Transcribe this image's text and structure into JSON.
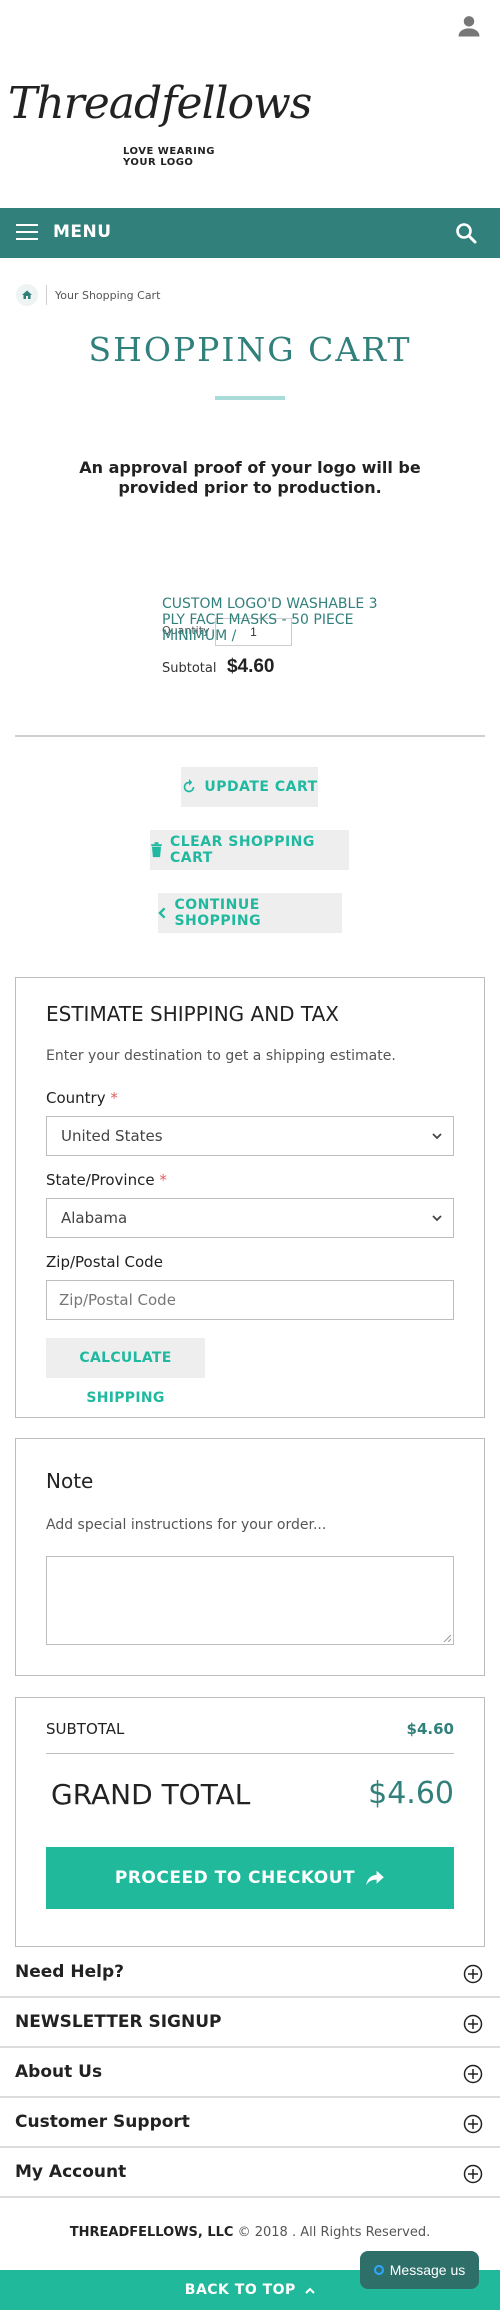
{
  "header": {
    "logo_text": "Threadfellows",
    "logo_tagline": "LOVE WEARING YOUR LOGO",
    "user_icon": "user-icon"
  },
  "nav": {
    "menu_label": "MENU",
    "menu_icon": "hamburger-icon",
    "search_icon": "search-icon",
    "bar_color": "#32807b"
  },
  "breadcrumb": {
    "home_icon": "home-icon",
    "current": "Your Shopping Cart"
  },
  "page": {
    "title": "SHOPPING CART",
    "approval_notice": "An approval proof of your logo will be provided prior to production."
  },
  "cart": {
    "item_name": "CUSTOM LOGO'D WASHABLE 3 PLY FACE MASKS - 50 PIECE MINIMUM /",
    "quantity_label": "Quantity",
    "quantity_value": "1",
    "subtotal_label": "Subtotal",
    "subtotal_value": "$4.60"
  },
  "actions": {
    "update_cart": "UPDATE CART",
    "clear_cart": "CLEAR SHOPPING CART",
    "continue_shopping": "CONTINUE SHOPPING"
  },
  "shipping": {
    "heading": "ESTIMATE SHIPPING AND TAX",
    "description": "Enter your destination to get a shipping estimate.",
    "country_label": "Country",
    "country_value": "United States",
    "state_label": "State/Province",
    "state_value": "Alabama",
    "zip_label": "Zip/Postal Code",
    "zip_placeholder": "Zip/Postal Code",
    "calculate_button": "CALCULATE SHIPPING",
    "required_mark": "*"
  },
  "note": {
    "heading": "Note",
    "description": "Add special instructions for your order..."
  },
  "totals": {
    "subtotal_label": "SUBTOTAL",
    "subtotal_value": "$4.60",
    "grand_total_label": "GRAND TOTAL",
    "grand_total_value": "$4.60",
    "checkout_button": "PROCEED TO CHECKOUT"
  },
  "footer": {
    "sections": [
      "Need Help?",
      "NEWSLETTER SIGNUP",
      "About Us",
      "Customer Support",
      "My Account"
    ],
    "company": "THREADFELLOWS, LLC",
    "copyright": "© 2018 . All Rights Reserved.",
    "back_to_top": "BACK TO TOP",
    "message_button": "Message us"
  },
  "colors": {
    "brand_teal": "#32807b",
    "accent_green": "#20b99c",
    "button_gray": "#eeeeee"
  }
}
